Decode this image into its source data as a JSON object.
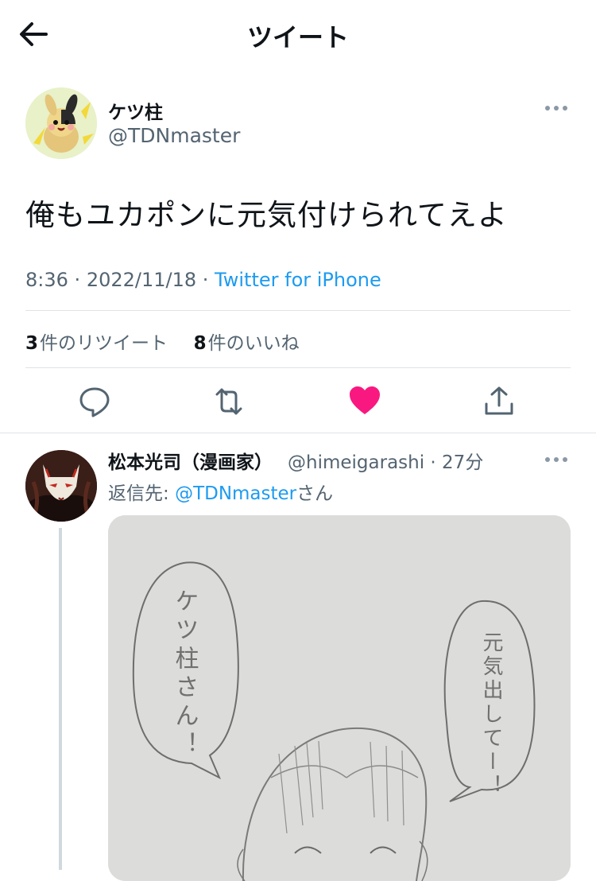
{
  "header": {
    "title": "ツイート",
    "back_icon": "back-arrow-icon"
  },
  "tweet": {
    "author_name": "ケツ柱",
    "author_handle": "@TDNmaster",
    "text": "俺もユカポンに元気付けられてえよ",
    "time": "8:36",
    "date": "2022/11/18",
    "source": "Twitter for iPhone",
    "retweet_count": "3",
    "retweet_label": "件のリツイート",
    "like_count": "8",
    "like_label": "件のいいね",
    "liked": true,
    "colors": {
      "accent": "#1d9bf0",
      "like": "#f91880",
      "muted": "#536471"
    }
  },
  "reply": {
    "author_name": "松本光司（漫画家）",
    "author_handle": "@himeigarashi",
    "time_ago": "27分",
    "reply_to_prefix": "返信先: ",
    "reply_to_handle": "@TDNmaster",
    "reply_to_suffix": "さん",
    "image": {
      "bubble_left_text": "ケツ柱さん！",
      "bubble_right_text": "元気出してー！"
    }
  }
}
